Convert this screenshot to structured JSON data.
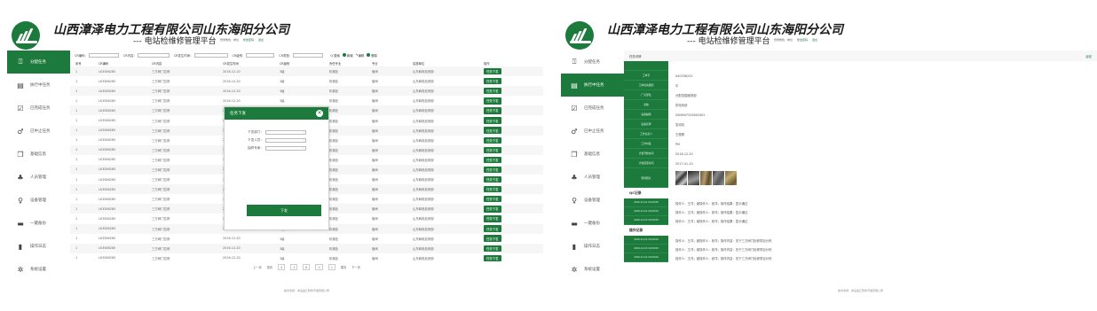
{
  "header": {
    "company": "山西漳泽电力工程有限公司山东海阳分公司",
    "subtitle": "--- 电站检维修管理平台",
    "user_role": "登录角色：单位",
    "user_pwd": "修改密码",
    "user_exit": "退出"
  },
  "sidebar": {
    "items": [
      {
        "label": "分配任务",
        "icon": "upload-icon",
        "active": true
      },
      {
        "label": "执行中任务",
        "icon": "list-icon",
        "active": false
      },
      {
        "label": "已完成任务",
        "icon": "checkbox-icon",
        "active": false
      },
      {
        "label": "已中止任务",
        "icon": "link-icon",
        "active": false
      },
      {
        "label": "基础信息",
        "icon": "copy-icon",
        "active": false
      },
      {
        "label": "人员管理",
        "icon": "users-icon",
        "active": false
      },
      {
        "label": "设备管理",
        "icon": "device-icon",
        "active": false
      },
      {
        "label": "一键备份",
        "icon": "folder-icon",
        "active": false
      },
      {
        "label": "操作日志",
        "icon": "book-icon",
        "active": false
      },
      {
        "label": "系统设置",
        "icon": "gear-icon",
        "active": false
      }
    ],
    "right_active_index": 1
  },
  "filter": {
    "code_label": "CR编码：",
    "content_label": "CR内容：",
    "time_label": "CR发生时间：",
    "level_label": "CR级别：",
    "type_label": "CR类型：",
    "search": "Q 搜索",
    "add": "新增",
    "edit": "编辑",
    "delete": "删除"
  },
  "table": {
    "columns": [
      "序号",
      "CR编码",
      "CR内容",
      "CR发生时间",
      "CR级别",
      "责任专业",
      "专业",
      "实施单位",
      "操作"
    ],
    "rows": [
      [
        "1",
        "LK3586285",
        "三方阀门拉修",
        "2016-12-20",
        "3级",
        "机械处",
        "管阀",
        "山东韩电检修部",
        "任务下发"
      ],
      [
        "1",
        "LK3586285",
        "三方阀门拉修",
        "2016-12-20",
        "3级",
        "机械处",
        "管阀",
        "山东韩电检修部",
        "任务下发"
      ],
      [
        "1",
        "LK3586285",
        "三方阀门拉修",
        "2016-12-20",
        "3级",
        "机械处",
        "管阀",
        "山东韩电检修部",
        "任务下发"
      ],
      [
        "1",
        "LK3586285",
        "三方阀门拉修",
        "2016-12-20",
        "3级",
        "机械处",
        "管阀",
        "山东韩电检修部",
        "任务下发"
      ],
      [
        "1",
        "LK3586285",
        "三方阀门拉修",
        "2016-12-20",
        "3级",
        "机械处",
        "管阀",
        "山东韩电检修部",
        "任务下发"
      ],
      [
        "1",
        "LK3586285",
        "三方阀门拉修",
        "2016-12-20",
        "3级",
        "机械处",
        "管阀",
        "山东韩电检修部",
        "任务下发"
      ],
      [
        "1",
        "LK3586285",
        "三方阀门拉修",
        "2016-12-20",
        "3级",
        "机械处",
        "管阀",
        "山东韩电检修部",
        "任务下发"
      ],
      [
        "1",
        "LK3586285",
        "三方阀门拉修",
        "2016-12-20",
        "3级",
        "机械处",
        "管阀",
        "山东韩电检修部",
        "任务下发"
      ],
      [
        "1",
        "LK3586285",
        "三方阀门拉修",
        "2016-12-20",
        "3级",
        "机械处",
        "管阀",
        "山东韩电检修部",
        "任务下发"
      ],
      [
        "1",
        "LK3586285",
        "三方阀门拉修",
        "2016-12-20",
        "3级",
        "机械处",
        "管阀",
        "山东韩电检修部",
        "任务下发"
      ],
      [
        "1",
        "LK3586285",
        "三方阀门拉修",
        "2016-12-20",
        "3级",
        "机械处",
        "管阀",
        "山东韩电检修部",
        "任务下发"
      ],
      [
        "1",
        "LK3586285",
        "三方阀门拉修",
        "2016-12-20",
        "3级",
        "机械处",
        "管阀",
        "山东韩电检修部",
        "任务下发"
      ],
      [
        "1",
        "LK3586285",
        "三方阀门拉修",
        "2016-12-20",
        "3级",
        "机械处",
        "管阀",
        "山东韩电检修部",
        "任务下发"
      ],
      [
        "1",
        "LK3586285",
        "三方阀门拉修",
        "2016-12-20",
        "3级",
        "机械处",
        "管阀",
        "山东韩电检修部",
        "任务下发"
      ],
      [
        "1",
        "LK3586285",
        "三方阀门拉修",
        "2016-12-20",
        "3级",
        "机械处",
        "管阀",
        "山东韩电检修部",
        "任务下发"
      ],
      [
        "1",
        "LK3586285",
        "三方阀门拉修",
        "2016-12-20",
        "3级",
        "机械处",
        "管阀",
        "山东韩电检修部",
        "任务下发"
      ],
      [
        "1",
        "LK3586285",
        "三方阀门拉修",
        "2016-12-20",
        "3级",
        "机械处",
        "管阀",
        "山东韩电检修部",
        "任务下发"
      ],
      [
        "1",
        "LK3586285",
        "三方阀门拉修",
        "2016-12-20",
        "3级",
        "机械处",
        "管阀",
        "山东韩电检修部",
        "任务下发"
      ],
      [
        "1",
        "LK3586285",
        "三方阀门拉修",
        "2016-12-20",
        "3级",
        "机械处",
        "管阀",
        "山东韩电检修部",
        "任务下发"
      ],
      [
        "1",
        "LK3586285",
        "三方阀门拉修",
        "2016-12-20",
        "3级",
        "机械处",
        "管阀",
        "山东韩电检修部",
        "任务下发"
      ]
    ]
  },
  "pager": {
    "prev": "上一页",
    "first": "首页",
    "pages": [
      "4",
      "1",
      "6",
      "<",
      "1"
    ],
    "last": "尾页",
    "next": "下一页"
  },
  "footer": "技术支持：青岛金汇软件开发有限公司",
  "modal": {
    "title": "任务下发",
    "close": "✕",
    "dept_label": "下发部门：",
    "person_label": "下发人员：",
    "expert_label": "抽样专家：",
    "submit": "下发"
  },
  "detail": {
    "title": "任务详情",
    "back": "返回",
    "fields": [
      {
        "label": "",
        "value": ""
      },
      {
        "label": "工单号",
        "value": "040336223"
      },
      {
        "label": "工单优先级别",
        "value": "中"
      },
      {
        "label": "厂房部位",
        "value": "分配范围维修部"
      },
      {
        "label": "系统",
        "value": "供电系统"
      },
      {
        "label": "设备编码",
        "value": "0SNM4752S802402"
      },
      {
        "label": "设备名称",
        "value": "发动机"
      },
      {
        "label": "工作负责人",
        "value": "王程刚"
      },
      {
        "label": "工作时段",
        "value": "PM"
      },
      {
        "label": "计划开始时间",
        "value": "2016-12-20"
      },
      {
        "label": "计划结束时间",
        "value": "2017-01-10"
      }
    ],
    "photos_label": "现场照片",
    "qc_title": "QC记录",
    "qc_rows": [
      {
        "time": "2016-12-10 10:00:00",
        "text": "操作人：王洋；被操作人：张洋；操作结果：显示通过"
      },
      {
        "time": "2016-12-10 10:00:00",
        "text": "操作人：王洋；被操作人：张洋；操作结果：显示通过"
      },
      {
        "time": "2016-12-10 10:00:00",
        "text": "操作人：王洋；被操作人：张洋；操作结果：显示通过"
      }
    ],
    "log_title": "操作记录",
    "log_rows": [
      {
        "time": "2016-12-10 10:00:00",
        "text": "操作人：王洋；被操作人：张洋；操作内容：关于三方阀门检修项目分布"
      },
      {
        "time": "2016-12-10 10:00:00",
        "text": "操作人：王洋；被操作人：张洋；操作内容：关于三方阀门检修项目分布"
      },
      {
        "time": "2016-12-10 10:00:00",
        "text": "操作人：王洋；被操作人：张洋；操作内容：关于三方阀门检修项目分布"
      }
    ]
  },
  "colors": {
    "brand_green": "#1c7a3c"
  }
}
